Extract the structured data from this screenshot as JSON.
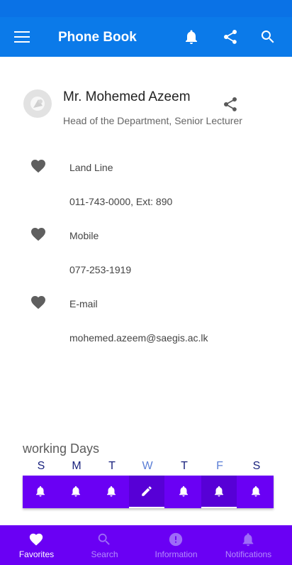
{
  "appbar": {
    "title": "Phone Book"
  },
  "contact": {
    "name": "Mr. Mohemed Azeem",
    "position": "Head of the Department, Senior Lecturer"
  },
  "details": [
    {
      "label": "Land Line",
      "value": "011-743-0000, Ext: 890"
    },
    {
      "label": "Mobile",
      "value": "077-253-1919"
    },
    {
      "label": "E-mail",
      "value": "mohemed.azeem@saegis.ac.lk"
    }
  ],
  "working_days": {
    "title": "working Days",
    "days": [
      {
        "letter": "S",
        "color": "#1a237e",
        "icon": "bell-icon",
        "selected": false
      },
      {
        "letter": "M",
        "color": "#1a237e",
        "icon": "bell-icon",
        "selected": false
      },
      {
        "letter": "T",
        "color": "#1a237e",
        "icon": "bell-icon",
        "selected": false
      },
      {
        "letter": "W",
        "color": "#5c7fd6",
        "icon": "edit-icon",
        "selected": true
      },
      {
        "letter": "T",
        "color": "#1a237e",
        "icon": "bell-icon",
        "selected": false
      },
      {
        "letter": "F",
        "color": "#5c7fd6",
        "icon": "bell-icon",
        "selected": true
      },
      {
        "letter": "S",
        "color": "#1a237e",
        "icon": "bell-icon",
        "selected": false
      }
    ]
  },
  "bottom_nav": [
    {
      "label": "Favorites",
      "icon": "heart-icon",
      "active": true
    },
    {
      "label": "Search",
      "icon": "search-icon",
      "active": false
    },
    {
      "label": "Information",
      "icon": "info-icon",
      "active": false
    },
    {
      "label": "Notifications",
      "icon": "bell-icon",
      "active": false
    }
  ],
  "colors": {
    "appbar": "#0b7ae9",
    "accent": "#6a00f4",
    "nav_inactive": "#b48cfb"
  }
}
